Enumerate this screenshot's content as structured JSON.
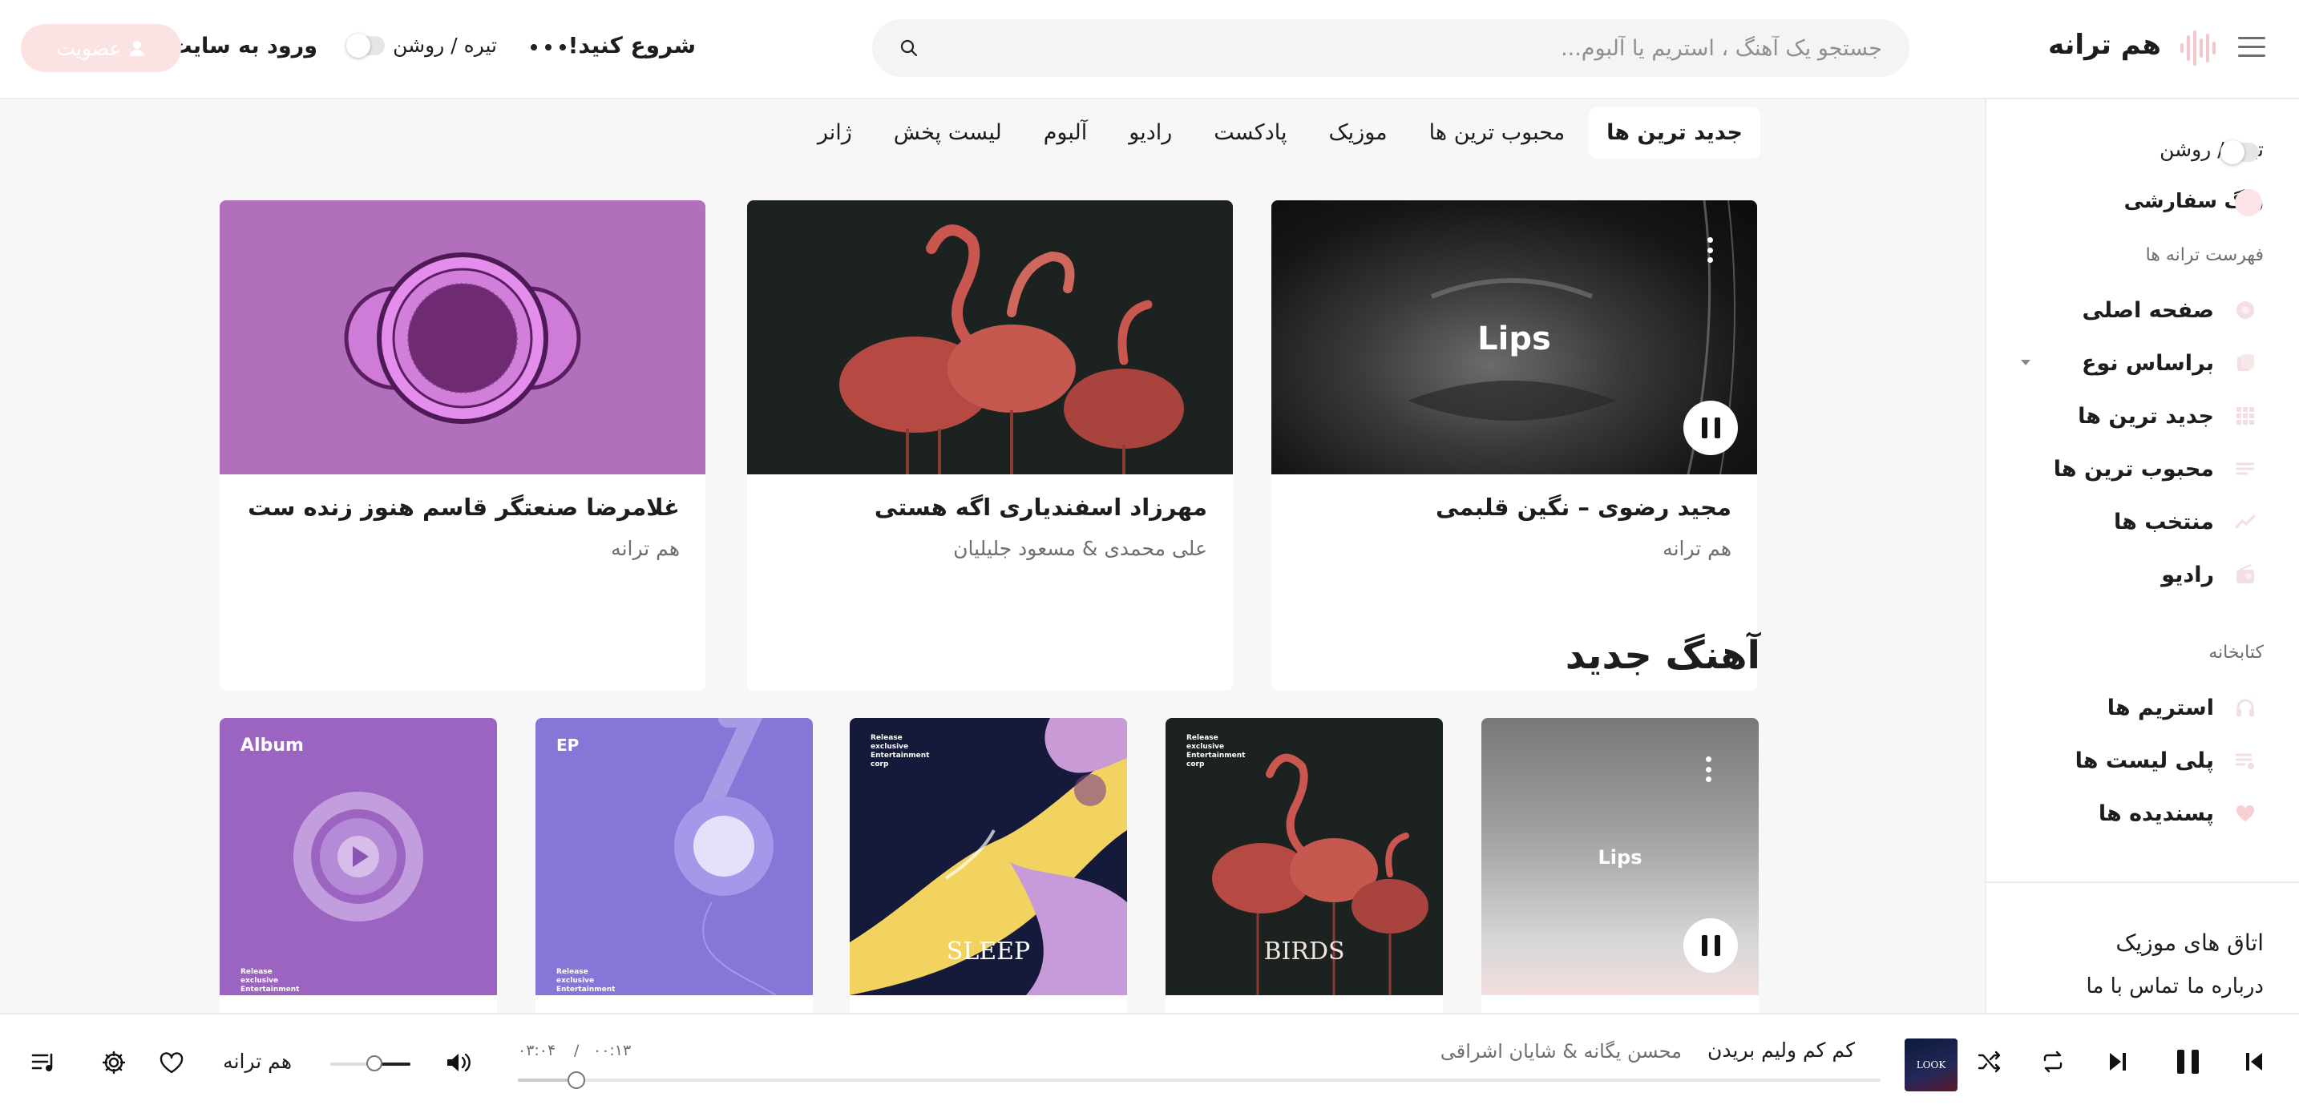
{
  "header": {
    "logo_text": "هم ترانه",
    "search_placeholder": "جستجو یک آهنگ ، استریم یا آلبوم...",
    "start_label": "شروع کنید!",
    "theme_label": "تیره / روشن",
    "login_label": "ورود به سایت",
    "register_label": "عضویت"
  },
  "sidebar": {
    "theme_label": "تیره / روشن",
    "custom_color_label": "رنگ سفارشی",
    "songs_heading": "فهرست ترانه ها",
    "nav": [
      {
        "label": "صفحه اصلی",
        "icon": "home-icon"
      },
      {
        "label": "براساس نوع",
        "icon": "category-icon"
      },
      {
        "label": "جدید ترین ها",
        "icon": "grid-icon"
      },
      {
        "label": "محبوب ترین ها",
        "icon": "list-icon"
      },
      {
        "label": "منتخب ها",
        "icon": "trending-icon"
      },
      {
        "label": "رادیو",
        "icon": "radio-icon"
      }
    ],
    "library_heading": "کتابخانه",
    "library": [
      {
        "label": "استریم ها",
        "icon": "headphones-icon"
      },
      {
        "label": "پلی لیست ها",
        "icon": "playlist-icon"
      },
      {
        "label": "پسندیده ها",
        "icon": "heart-icon"
      }
    ],
    "music_rooms_label": "اتاق های موزیک",
    "about_label": "درباره ما",
    "contact_label": "تماس با ما"
  },
  "tabs": [
    "جدید ترین ها",
    "محبوب ترین ها",
    "موزیک",
    "پادکست",
    "رادیو",
    "آلبوم",
    "لیست پخش",
    "ژانر"
  ],
  "featured": [
    {
      "title": "مجید رضوی – نگین قلبمی",
      "subtitle": "هم ترانه",
      "art_text": "Lips"
    },
    {
      "title": "مهرزاد اسفندیاری اگه هستی",
      "subtitle": "علی محمدی & مسعود جلیلیان"
    },
    {
      "title": "غلامرضا صنعتگر قاسم هنوز زنده ست",
      "subtitle": "هم ترانه"
    }
  ],
  "new_songs": {
    "title": "آهنگ جدید",
    "cards": [
      {
        "art_text": "Lips"
      },
      {
        "art_text": "BIRDS",
        "tag": "Release exclusive Entertainment corp"
      },
      {
        "art_text": "SLEEP",
        "tag": "Release exclusive Entertainment corp"
      },
      {
        "art_text": "EP",
        "tag": "Release exclusive Entertainment corp"
      },
      {
        "art_text": "Album",
        "tag": "Release exclusive Entertainment corp"
      }
    ]
  },
  "player": {
    "song_title": "کم کم ولیم بریدن",
    "artist": "محسن یگانه & شایان اشراقی",
    "cover_text": "LOOK",
    "time_current": "۰۰:۱۳",
    "time_separator": "/",
    "time_total": "۰۳:۰۴",
    "progress": 0.043,
    "volume": 0.45,
    "brand_label": "هم ترانه"
  }
}
